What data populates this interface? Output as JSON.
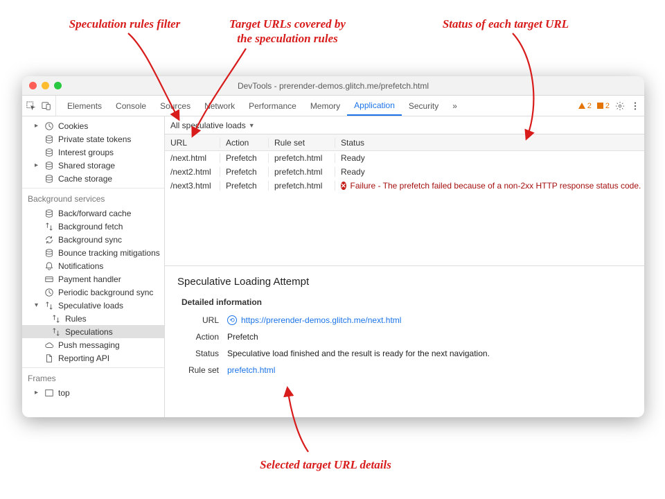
{
  "annotations": {
    "filter": "Speculation rules filter",
    "targets": "Target URLs covered by\nthe speculation rules",
    "status": "Status of each target URL",
    "details": "Selected target URL details"
  },
  "window": {
    "title": "DevTools - prerender-demos.glitch.me/prefetch.html"
  },
  "tabs": {
    "items": [
      "Elements",
      "Console",
      "Sources",
      "Network",
      "Performance",
      "Memory",
      "Application",
      "Security"
    ],
    "active": "Application",
    "overflow": "»",
    "warn1": "2",
    "warn2": "2"
  },
  "sidebar": {
    "section_storage": [
      {
        "label": "Cookies",
        "icon": "clock",
        "caret": "▸"
      },
      {
        "label": "Private state tokens",
        "icon": "db"
      },
      {
        "label": "Interest groups",
        "icon": "db"
      },
      {
        "label": "Shared storage",
        "icon": "db",
        "caret": "▸"
      },
      {
        "label": "Cache storage",
        "icon": "db"
      }
    ],
    "bg_title": "Background services",
    "bg": [
      {
        "label": "Back/forward cache",
        "icon": "db"
      },
      {
        "label": "Background fetch",
        "icon": "arrows"
      },
      {
        "label": "Background sync",
        "icon": "sync"
      },
      {
        "label": "Bounce tracking mitigations",
        "icon": "db"
      },
      {
        "label": "Notifications",
        "icon": "bell"
      },
      {
        "label": "Payment handler",
        "icon": "card"
      },
      {
        "label": "Periodic background sync",
        "icon": "clock"
      },
      {
        "label": "Speculative loads",
        "icon": "arrows",
        "caret": "▾",
        "expanded": true
      },
      {
        "label": "Rules",
        "icon": "arrows",
        "sub": true
      },
      {
        "label": "Speculations",
        "icon": "arrows",
        "sub": true,
        "selected": true
      },
      {
        "label": "Push messaging",
        "icon": "cloud"
      },
      {
        "label": "Reporting API",
        "icon": "doc"
      }
    ],
    "frames_title": "Frames",
    "frames": [
      {
        "label": "top",
        "icon": "frame",
        "caret": "▸"
      }
    ]
  },
  "toolbar": {
    "filter": "All speculative loads"
  },
  "grid": {
    "headers": {
      "url": "URL",
      "action": "Action",
      "ruleset": "Rule set",
      "status": "Status"
    },
    "rows": [
      {
        "url": "/next.html",
        "action": "Prefetch",
        "ruleset": "prefetch.html",
        "status": "Ready"
      },
      {
        "url": "/next2.html",
        "action": "Prefetch",
        "ruleset": "prefetch.html",
        "status": "Ready"
      },
      {
        "url": "/next3.html",
        "action": "Prefetch",
        "ruleset": "prefetch.html",
        "status": "Failure - The prefetch failed because of a non-2xx HTTP response status code.",
        "failure": true
      }
    ]
  },
  "details": {
    "title": "Speculative Loading Attempt",
    "subtitle": "Detailed information",
    "labels": {
      "url": "URL",
      "action": "Action",
      "status": "Status",
      "ruleset": "Rule set"
    },
    "url": "https://prerender-demos.glitch.me/next.html",
    "action": "Prefetch",
    "status": "Speculative load finished and the result is ready for the next navigation.",
    "ruleset": "prefetch.html"
  }
}
